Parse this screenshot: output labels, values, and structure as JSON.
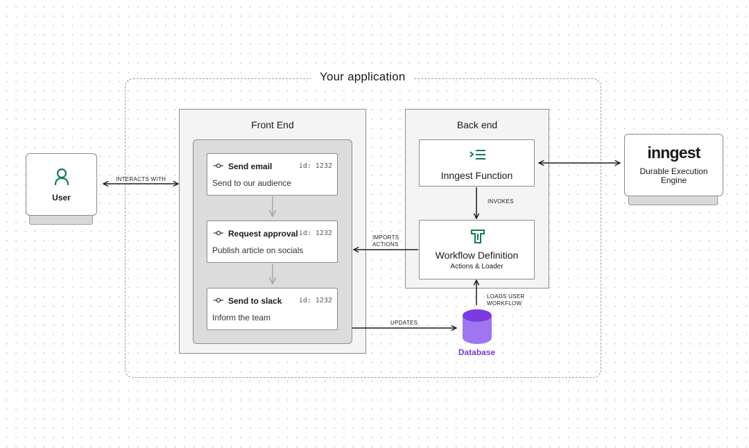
{
  "application": {
    "title": "Your application"
  },
  "user": {
    "label": "User",
    "icon": "user-icon"
  },
  "frontend": {
    "title": "Front End",
    "steps": [
      {
        "title": "Send email",
        "id_label": "id: 1232",
        "description": "Send to our audience"
      },
      {
        "title": "Request approval",
        "id_label": "id: 1232",
        "description": "Publish article on socials"
      },
      {
        "title": "Send to slack",
        "id_label": "id: 1232",
        "description": "Inform the team"
      }
    ]
  },
  "backend": {
    "title": "Back end",
    "function": {
      "title": "Inngest Function",
      "icon": "function-list-icon"
    },
    "workflow": {
      "title": "Workflow Definition",
      "subtitle": "Actions & Loader",
      "icon": "workflow-t-icon"
    }
  },
  "engine": {
    "brand": "inngest",
    "label_line1": "Durable Execution",
    "label_line2": "Engine"
  },
  "database": {
    "label": "Database",
    "icon": "database-icon"
  },
  "edges": {
    "interacts_with": "INTERACTS WITH",
    "invokes": "INVOKES",
    "imports_line1": "IMPORTS",
    "imports_line2": "ACTIONS",
    "updates": "UPDATES",
    "loads_line1": "LOADS USER",
    "loads_line2": "WORKFLOW"
  },
  "colors": {
    "accent_green": "#0f7d4a",
    "database_purple": "#8b50e8",
    "database_label": "#7d3bd6"
  }
}
